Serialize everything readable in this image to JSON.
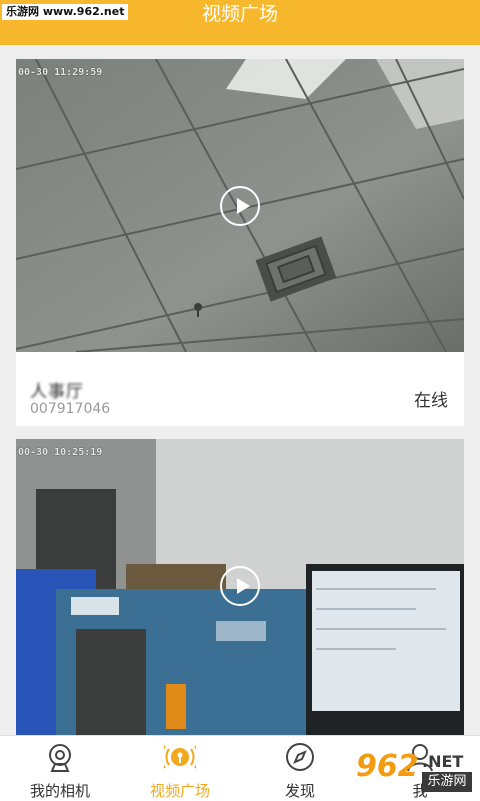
{
  "watermark_top": "乐游网 www.962.net",
  "header": {
    "title": "视频广场"
  },
  "cards": [
    {
      "timestamp": "00-30 11:29:59",
      "name": "人事厅",
      "id": "007917046",
      "status": "在线"
    },
    {
      "timestamp": "00-30 10:25:19",
      "name": "",
      "id": "",
      "status": ""
    }
  ],
  "tabs": [
    {
      "label": "我的相机",
      "icon": "camera-icon",
      "active": false
    },
    {
      "label": "视频广场",
      "icon": "broadcast-icon",
      "active": true
    },
    {
      "label": "发现",
      "icon": "compass-icon",
      "active": false
    },
    {
      "label": "我",
      "icon": "person-icon",
      "active": false
    }
  ],
  "watermark_bottom": {
    "logo": "962",
    "net": ".NET",
    "cn": "乐游网"
  },
  "colors": {
    "accent": "#f7b82d",
    "tab_active": "#f2a81d"
  }
}
